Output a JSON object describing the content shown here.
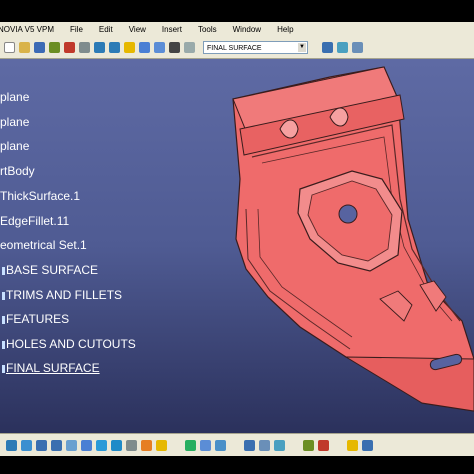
{
  "menubar": {
    "app_title": "NOVIA V5 VPM",
    "items": [
      "File",
      "Edit",
      "View",
      "Insert",
      "Tools",
      "Window",
      "Help"
    ]
  },
  "toolbar": {
    "current_set": "FINAL SURFACE",
    "icons": [
      "arrow-icon",
      "update-icon",
      "sketch-icon",
      "cut-icon",
      "undo-icon",
      "redo-icon",
      "help-icon",
      "measure-icon",
      "link-icon",
      "save-icon",
      "filter-icon",
      "compass-icon",
      "analysis-icon"
    ]
  },
  "tree": {
    "nodes": [
      {
        "label": "plane",
        "type": "feature"
      },
      {
        "label": "plane",
        "type": "feature"
      },
      {
        "label": "plane",
        "type": "feature"
      },
      {
        "label": "rtBody",
        "type": "feature"
      },
      {
        "label": "ThickSurface.1",
        "type": "feature"
      },
      {
        "label": "EdgeFillet.11",
        "type": "feature"
      },
      {
        "label": "eometrical Set.1",
        "type": "feature"
      },
      {
        "label": "BASE SURFACE",
        "type": "set"
      },
      {
        "label": "TRIMS AND FILLETS",
        "type": "set"
      },
      {
        "label": "FEATURES",
        "type": "set"
      },
      {
        "label": "HOLES AND CUTOUTS",
        "type": "set"
      },
      {
        "label": "FINAL SURFACE",
        "type": "set",
        "active": true
      }
    ]
  },
  "colors": {
    "part_fill": "#ef6b6b",
    "part_edge": "#3a1c1c",
    "background_top": "#5e6aa4",
    "background_bottom": "#2b315c"
  }
}
